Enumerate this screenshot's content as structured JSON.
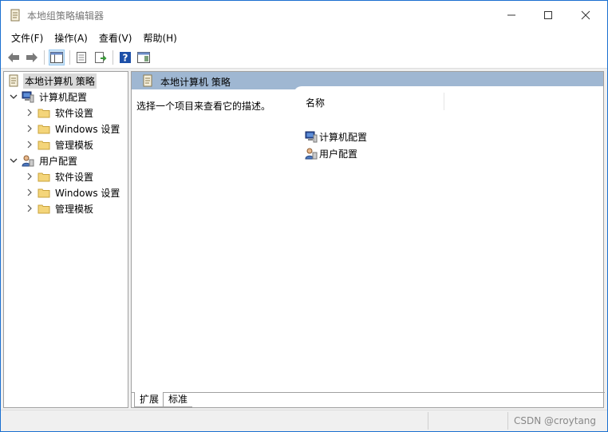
{
  "window": {
    "title": "本地组策略编辑器"
  },
  "menu": [
    "文件(F)",
    "操作(A)",
    "查看(V)",
    "帮助(H)"
  ],
  "tree": {
    "root": "本地计算机 策略",
    "computer_config": "计算机配置",
    "computer_children": [
      "软件设置",
      "Windows 设置",
      "管理模板"
    ],
    "user_config": "用户配置",
    "user_children": [
      "软件设置",
      "Windows 设置",
      "管理模板"
    ]
  },
  "content": {
    "header_title": "本地计算机 策略",
    "description": "选择一个项目来查看它的描述。",
    "column_name": "名称",
    "items": [
      "计算机配置",
      "用户配置"
    ]
  },
  "tabs": [
    "扩展",
    "标准"
  ],
  "status": {
    "watermark": "CSDN @croytang"
  },
  "colors": {
    "header_bar": "#9fb7d2",
    "window_border": "#1a6fd0"
  }
}
